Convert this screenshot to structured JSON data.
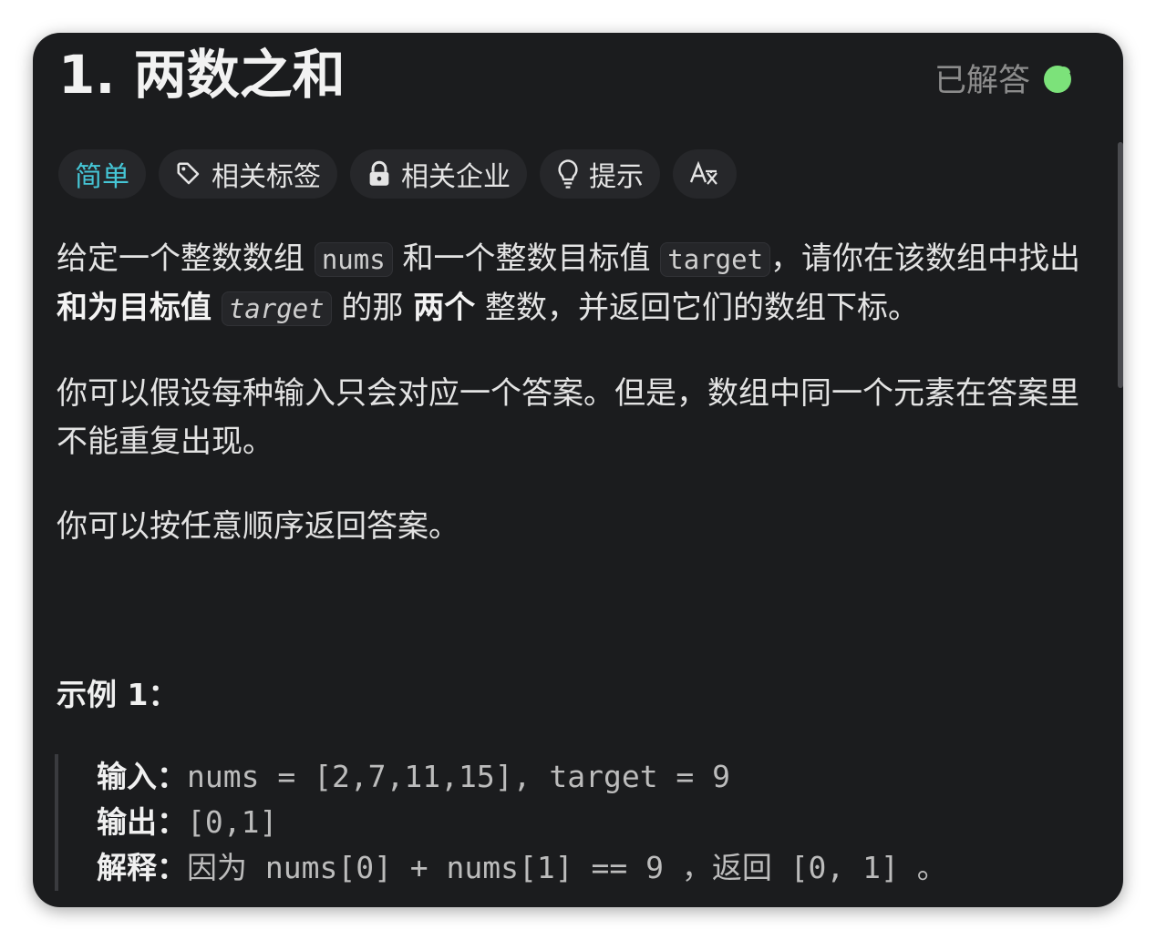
{
  "problem": {
    "title": "1. 两数之和",
    "status_label": "已解答",
    "status_color": "#7ce27a"
  },
  "tags": {
    "difficulty": "简单",
    "related_topics": "相关标签",
    "related_companies": "相关企业",
    "hints": "提示",
    "translate_icon": "translate-icon"
  },
  "description": {
    "p1_part1": "给定一个整数数组 ",
    "p1_code1": "nums",
    "p1_part2": " 和一个整数目标值 ",
    "p1_code2": "target",
    "p1_part3": "，请你在该数组中找出 ",
    "p1_bold1": "和为目标值",
    "p1_code3": "target",
    "p1_part4": " 的那 ",
    "p1_bold2": "两个",
    "p1_part5": " 整数，并返回它们的数组下标。",
    "p2": "你可以假设每种输入只会对应一个答案。但是，数组中同一个元素在答案里不能重复出现。",
    "p3": "你可以按任意顺序返回答案。"
  },
  "example": {
    "title": "示例 1：",
    "input_label": "输入：",
    "input_value": "nums = [2,7,11,15], target = 9",
    "output_label": "输出：",
    "output_value": "[0,1]",
    "explain_label": "解释：",
    "explain_value": "因为 nums[0] + nums[1] == 9 ，返回 [0, 1] 。"
  }
}
